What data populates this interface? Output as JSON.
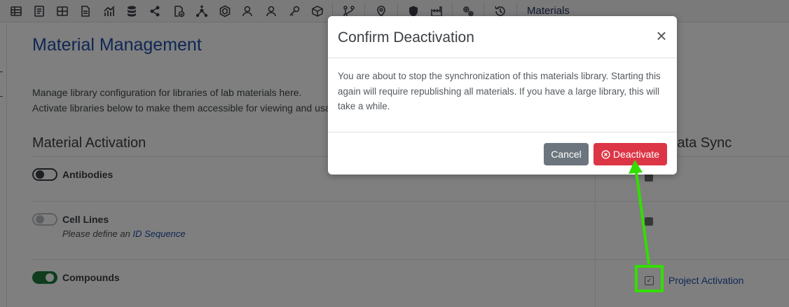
{
  "toolbar": {
    "icons": [
      "table-icon",
      "notebook-icon",
      "grid-icon",
      "document-icon",
      "chart-icon",
      "database-icon",
      "share-icon",
      "file-check-icon",
      "molecule-icon",
      "hexagon-icon",
      "users-icon",
      "user-icon",
      "key-icon",
      "cube-icon",
      "branch-icon",
      "location-icon",
      "shield-icon",
      "factory-icon",
      "gears-icon",
      "history-icon"
    ],
    "title": "Materials"
  },
  "page": {
    "title": "Material Management",
    "desc1": "Manage library configuration for libraries of lab materials here.",
    "desc2": "Activate libraries below to make them accessible for viewing and usage"
  },
  "columns": {
    "activation": "Material Activation",
    "sync": "Data Sync"
  },
  "materials": [
    {
      "name": "Antibodies",
      "toggle": "off"
    },
    {
      "name": "Cell Lines",
      "toggle": "disabled",
      "note_prefix": "Please define an ",
      "note_link": "ID Sequence"
    },
    {
      "name": "Compounds",
      "toggle": "on",
      "sync_link": "Project Activation"
    }
  ],
  "modal": {
    "title": "Confirm Deactivation",
    "close": "×",
    "body": "You are about to stop the synchronization of this materials library. Starting this again will require republishing all materials. If you have a large library, this will take a while.",
    "cancel_label": "Cancel",
    "deactivate_label": "Deactivate"
  },
  "colors": {
    "accent": "#1f4fa8",
    "danger": "#dc3545",
    "secondary": "#6c757d",
    "toggle_on": "#1f7a3a",
    "annotation": "#33dd00"
  }
}
